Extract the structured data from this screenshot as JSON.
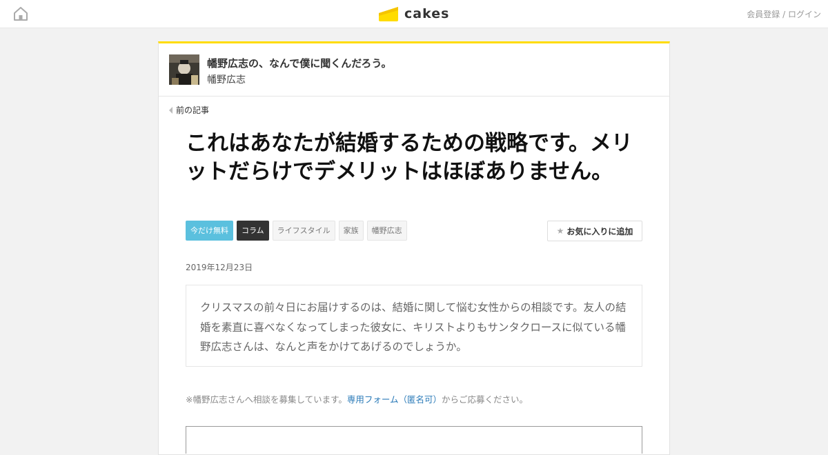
{
  "header": {
    "logo_text": "cakes",
    "register_label": "会員登録",
    "separator": "/",
    "login_label": "ログイン",
    "brand_color": "#ffdc00"
  },
  "series": {
    "title": "幡野広志の、なんで僕に聞くんだろう。",
    "author": "幡野広志"
  },
  "nav": {
    "prev_label": "前の記事"
  },
  "article": {
    "title": "これはあなたが結婚するための戦略です。メリットだらけでデメリットはほぼありません。",
    "tags": [
      {
        "label": "今だけ無料",
        "style": "free"
      },
      {
        "label": "コラム",
        "style": "dark"
      },
      {
        "label": "ライフスタイル",
        "style": "plain"
      },
      {
        "label": "家族",
        "style": "plain"
      },
      {
        "label": "幡野広志",
        "style": "plain"
      }
    ],
    "favorite_label": "お気に入りに追加",
    "date": "2019年12月23日",
    "lead": "クリスマスの前々日にお届けするのは、結婚に関して悩む女性からの相談です。友人の結婚を素直に喜べなくなってしまった彼女に、キリストよりもサンタクロースに似ている幡野広志さんは、なんと声をかけてあげるのでしょうか。",
    "note_prefix": "※幡野広志さんへ相談を募集しています。",
    "note_link": "専用フォーム（匿名可）",
    "note_suffix": "からご応募ください。"
  },
  "icons": {
    "home": "home-icon",
    "logo": "cake-logo-icon",
    "prev": "triangle-left-icon",
    "favorite": "star-icon"
  }
}
